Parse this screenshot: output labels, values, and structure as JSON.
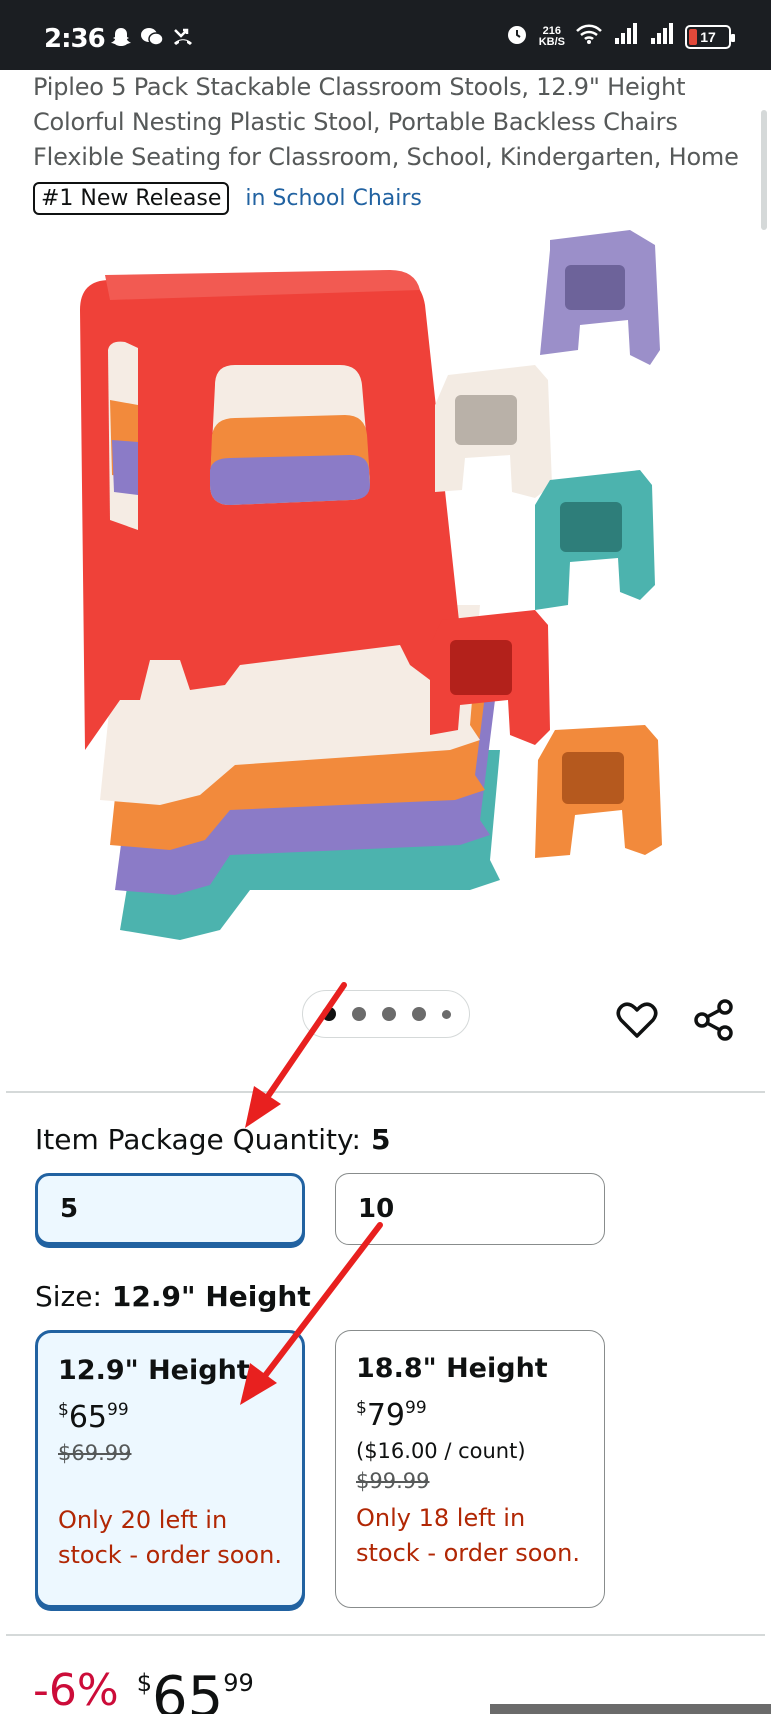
{
  "status_bar": {
    "time": "2:36",
    "left_icons": [
      "snapchat-icon",
      "wechat-icon",
      "missed-call-icon"
    ],
    "speed_value": "216",
    "speed_unit": "KB/S",
    "battery": "17"
  },
  "product": {
    "title": "Pipleo 5 Pack Stackable Classroom Stools, 12.9\" Height Colorful Nesting Plastic Stool, Portable Backless Chairs Flexible Seating for Classroom, School, Kindergarten, Home",
    "badge": "#1 New Release",
    "badge_category": "in School Chairs"
  },
  "carousel": {
    "dot_count": 5,
    "active_index": 0
  },
  "quantity": {
    "label": "Item Package Quantity:",
    "value": "5",
    "options": [
      {
        "label": "5",
        "selected": true
      },
      {
        "label": "10",
        "selected": false
      }
    ]
  },
  "size": {
    "label": "Size:",
    "value": "12.9\" Height",
    "options": [
      {
        "title": "12.9\" Height",
        "price_whole": "65",
        "price_fraction": "99",
        "currency": "$",
        "per_count": "",
        "list_price": "$69.99",
        "stock": "Only 20 left in stock - order soon.",
        "selected": true
      },
      {
        "title": "18.8\" Height",
        "price_whole": "79",
        "price_fraction": "99",
        "currency": "$",
        "per_count": "($16.00 / count)",
        "list_price": "$99.99",
        "stock": "Only 18 left in stock - order soon.",
        "selected": false
      }
    ]
  },
  "buybox": {
    "discount": "-6%",
    "currency": "$",
    "price_whole": "65",
    "price_fraction": "99"
  },
  "colors": {
    "accent": "#2162a1",
    "selected_bg": "#edf8ff",
    "stock_red": "#b12704",
    "discount_red": "#cc0c39",
    "annotation_red": "#e8201f"
  }
}
